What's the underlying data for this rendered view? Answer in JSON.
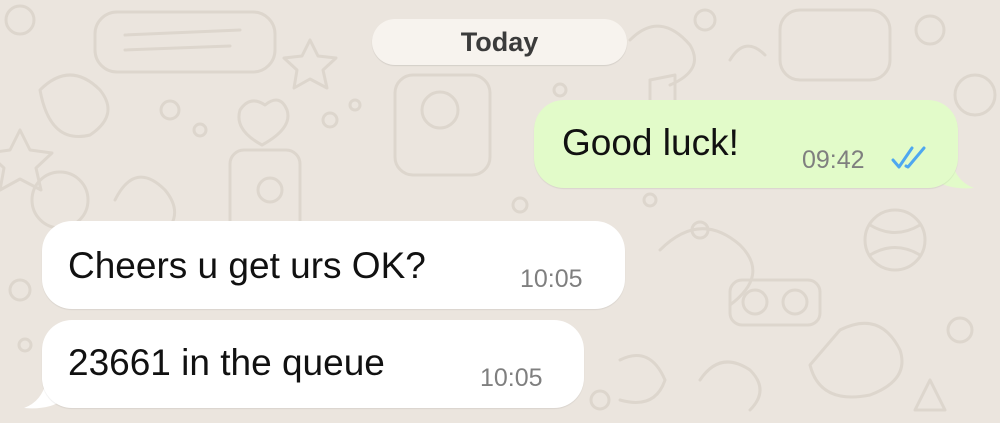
{
  "chat": {
    "date_divider": "Today",
    "messages": [
      {
        "direction": "outgoing",
        "text": "Good luck!",
        "time": "09:42",
        "status_icon": "double-check-read-icon",
        "status_color": "#4ea7f0"
      },
      {
        "direction": "incoming",
        "text": "Cheers u get urs OK?",
        "time": "10:05"
      },
      {
        "direction": "incoming",
        "text": "23661 in the queue",
        "time": "10:05"
      }
    ]
  },
  "colors": {
    "wallpaper": "#ebe5de",
    "outgoing_bubble": "#e2fbc9",
    "incoming_bubble": "#ffffff",
    "date_pill": "#f7f3ee"
  }
}
